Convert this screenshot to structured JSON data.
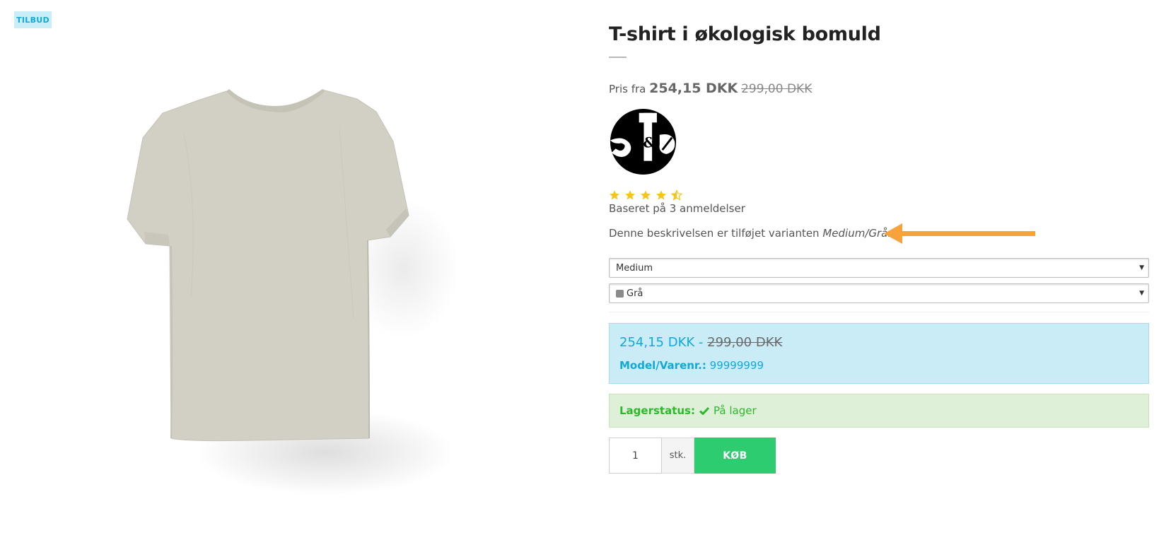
{
  "badge": {
    "label": "TILBUD"
  },
  "product": {
    "title": "T-shirt i økologisk bomuld",
    "price_prefix": "Pris fra",
    "price_now": "254,15 DKK",
    "price_old": "299,00 DKK"
  },
  "logo": {
    "icon": "brand-logo"
  },
  "rating": {
    "stars": 4.5,
    "max": 5,
    "reviews_label": "Baseret på 3 anmeldelser"
  },
  "variant_note": {
    "text": "Denne beskrivelsen er tilføjet varianten ",
    "variant": "Medium/Grå",
    "suffix": "..."
  },
  "options": {
    "size": {
      "selected": "Medium"
    },
    "color": {
      "selected": "Grå",
      "swatch": "#8a8a8a"
    }
  },
  "price_box": {
    "price_from": "254,15 DKK",
    "separator": " - ",
    "price_old": "299,00 DKK",
    "model_label": "Model/Varenr.:",
    "model_value": "99999999"
  },
  "stock": {
    "label": "Lagerstatus:",
    "value": "På lager",
    "icon": "check-icon"
  },
  "cart": {
    "quantity": "1",
    "unit": "stk.",
    "buy_label": "KØB"
  },
  "colors": {
    "accent_blue": "#12a9d6",
    "buy_green": "#2ecc71",
    "arrow_orange": "#f7a23b",
    "shirt": "#d2d0c4"
  }
}
